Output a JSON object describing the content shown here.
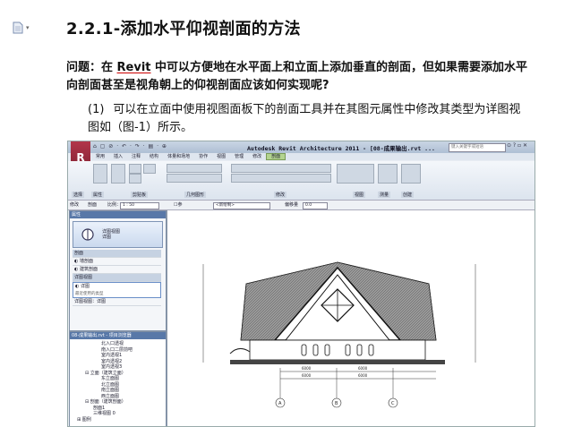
{
  "doc": {
    "title": "2.2.1-添加水平仰视剖面的方法",
    "question_prefix": "问题：在 ",
    "question_keyword": "Revit",
    "question_rest": " 中可以方便地在水平面上和立面上添加垂直的剖面，但如果需要添加水平向剖面甚至是视角朝上的仰视剖面应该如何实现呢?",
    "para_num": "(1)",
    "para_line1": "可以在立面中使用视图面板下的剖面工具并在其图元属性中修改其类型为详图视",
    "para_line2": "图如（图-1）所示。"
  },
  "screenshot": {
    "quick_access": "⌂ ▢ ⊘ · ↶ · ↷ · ▤ · ⊕",
    "app_title": "Autodesk Revit Architecture 2011 - [08-成果输出.rvt ...",
    "search_placeholder": "键入关键字或短语",
    "logo": "R",
    "tabs": [
      "常用",
      "插入",
      "注释",
      "结构",
      "体量和场地",
      "协作",
      "视图",
      "管理",
      "修改",
      "剖面"
    ],
    "active_tab": "剖面",
    "ribbon_groups": [
      "选择",
      "属性",
      "剪贴板",
      "几何图形",
      "修改",
      "视图",
      "测量",
      "创建"
    ],
    "options_bar": {
      "modify": "修改",
      "section": "剖面",
      "scale_label": "比例：",
      "scale_value": "1 : 50",
      "reference_label": "参照其他视图",
      "reference_value": "<新绘制>",
      "offset_label": "偏移量",
      "offset_value": "0.0"
    },
    "properties": {
      "header": "属性",
      "type_line1": "详图视图",
      "type_line2": "详图",
      "rows": [
        "剖面",
        "墙剖面",
        "建筑剖面",
        "详图视图",
        "详图",
        "最近使用的类型",
        "详图视图：详图"
      ]
    },
    "browser": {
      "header": "08-成果输出.rvt - 项目浏览器",
      "items": [
        "北入口透视",
        "南入口二层前吧",
        "室内透视1",
        "室内透视2",
        "室内透视3",
        "立面（建筑立面）",
        "东立面图",
        "北立面图",
        "南立面图",
        "西立面图",
        "剖面（建筑剖面）",
        "剖面1",
        "三维视图 0",
        "图例"
      ]
    },
    "drawing": {
      "grid_labels": [
        "A",
        "B",
        "C"
      ],
      "dim_labels": [
        "6000",
        "6000",
        "6000",
        "6000"
      ]
    }
  }
}
